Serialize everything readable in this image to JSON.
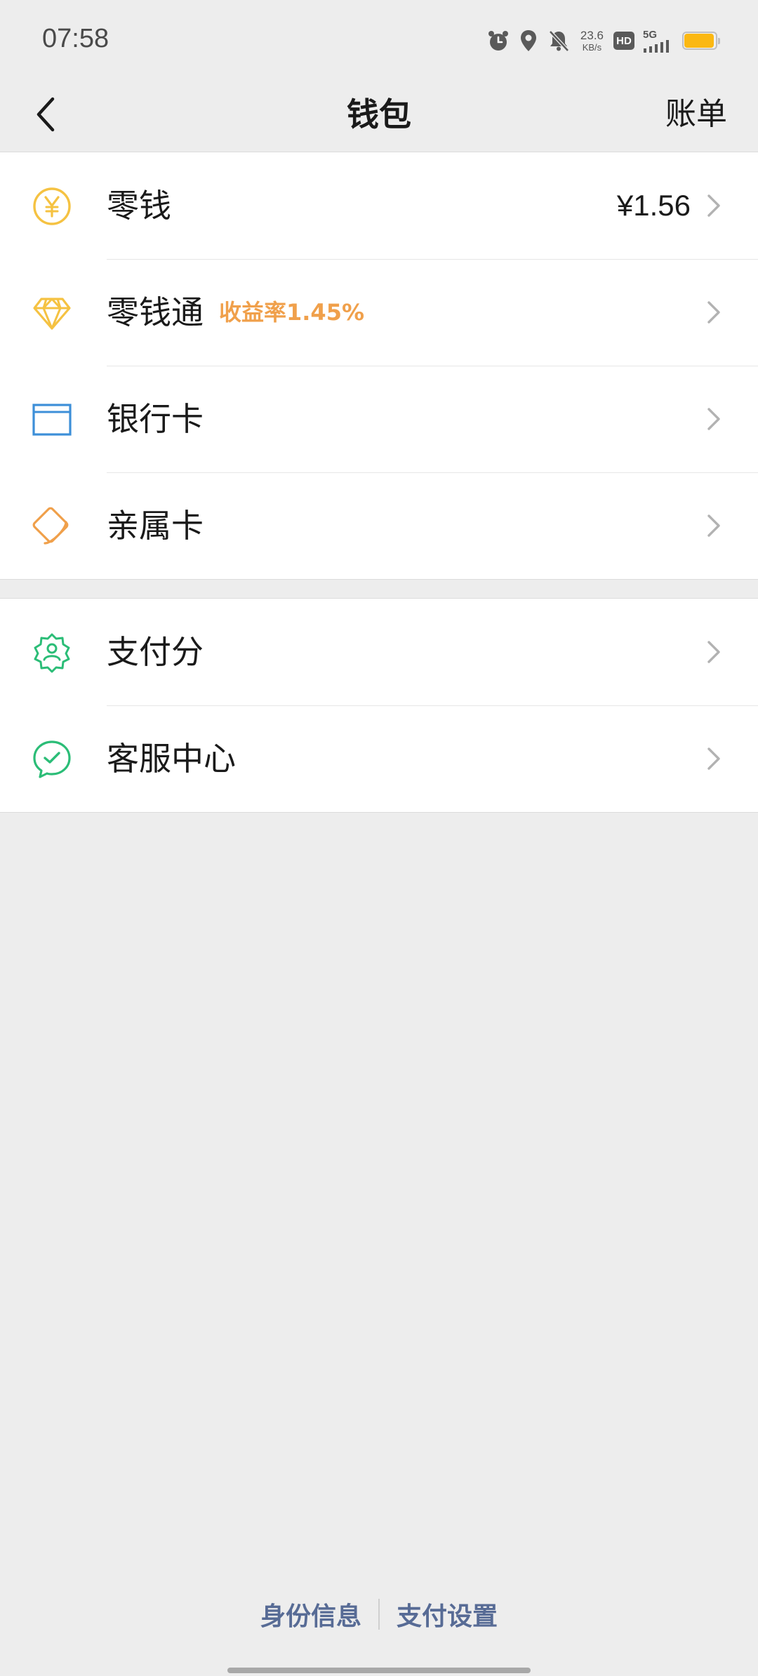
{
  "status_bar": {
    "time": "07:58",
    "net_speed_value": "23.6",
    "net_speed_unit": "KB/s",
    "hd_label": "HD",
    "network_label": "5G",
    "battery_level": 0.95,
    "battery_color": "#fbb812"
  },
  "nav": {
    "back_icon": "chevron-left-icon",
    "title": "钱包",
    "bill_label": "账单"
  },
  "groups": [
    {
      "items": [
        {
          "icon": "yuan-coin-icon",
          "label": "零钱",
          "value": "¥1.56",
          "color": "#f5c242"
        },
        {
          "icon": "diamond-icon",
          "label": "零钱通",
          "sub": "收益率1.45%",
          "color": "#f5c242"
        },
        {
          "icon": "bank-card-icon",
          "label": "银行卡",
          "color": "#3d8fd8"
        },
        {
          "icon": "family-card-icon",
          "label": "亲属卡",
          "color": "#f0a04b"
        }
      ]
    },
    {
      "items": [
        {
          "icon": "pay-score-icon",
          "label": "支付分",
          "color": "#2bbd77"
        },
        {
          "icon": "customer-service-icon",
          "label": "客服中心",
          "color": "#2bbd77"
        }
      ]
    }
  ],
  "footer": {
    "identity_label": "身份信息",
    "settings_label": "支付设置",
    "link_color": "#576b95"
  }
}
